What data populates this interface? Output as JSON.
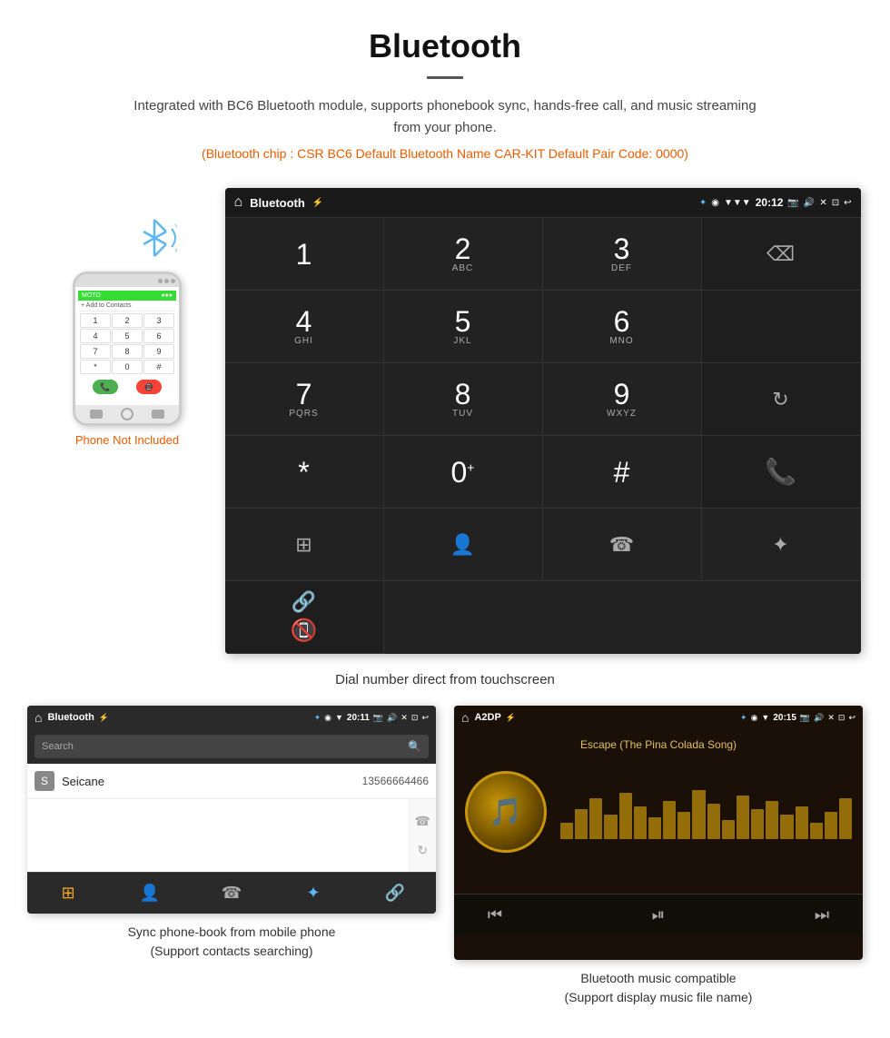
{
  "page": {
    "title": "Bluetooth",
    "divider": true,
    "description": "Integrated with BC6 Bluetooth module, supports phonebook sync, hands-free call, and music streaming from your phone.",
    "specs": "(Bluetooth chip : CSR BC6    Default Bluetooth Name CAR-KIT    Default Pair Code: 0000)",
    "dial_caption": "Dial number direct from touchscreen",
    "phonebook_caption": "Sync phone-book from mobile phone\n(Support contacts searching)",
    "music_caption": "Bluetooth music compatible\n(Support display music file name)"
  },
  "status_bar": {
    "title": "Bluetooth",
    "time": "20:12"
  },
  "phonebook_status": {
    "title": "Bluetooth",
    "time": "20:11"
  },
  "music_status": {
    "title": "A2DP",
    "time": "20:15"
  },
  "keypad": {
    "keys": [
      {
        "main": "1",
        "sub": ""
      },
      {
        "main": "2",
        "sub": "ABC"
      },
      {
        "main": "3",
        "sub": "DEF"
      },
      {
        "main": "4",
        "sub": "GHI"
      },
      {
        "main": "5",
        "sub": "JKL"
      },
      {
        "main": "6",
        "sub": "MNO"
      },
      {
        "main": "7",
        "sub": "PQRS"
      },
      {
        "main": "8",
        "sub": "TUV"
      },
      {
        "main": "9",
        "sub": "WXYZ"
      },
      {
        "main": "*",
        "sub": ""
      },
      {
        "main": "0+",
        "sub": ""
      },
      {
        "main": "#",
        "sub": ""
      }
    ]
  },
  "phone": {
    "not_included_label_orange": "Phone Not",
    "not_included_label_gray": "Included"
  },
  "phonebook": {
    "search_placeholder": "Search",
    "contact_letter": "S",
    "contact_name": "Seicane",
    "contact_number": "13566664466"
  },
  "music": {
    "song_title": "Escape (The Pina Colada Song)"
  },
  "icons": {
    "home": "⌂",
    "usb": "⚡",
    "bluetooth": "✦",
    "location": "◉",
    "wifi": "▼",
    "camera": "📷",
    "volume": "🔊",
    "close_x": "✕",
    "fullscreen": "⊡",
    "back": "↩",
    "backspace": "⌫",
    "refresh": "↻",
    "call_phone": "📞",
    "end_call": "📵",
    "keypad_grid": "⊞",
    "contact": "👤",
    "phone_outline": "☎",
    "bt_sym": "⊕",
    "link": "🔗",
    "skip_prev": "⏮",
    "play_pause": "⏯",
    "skip_next": "⏭"
  }
}
